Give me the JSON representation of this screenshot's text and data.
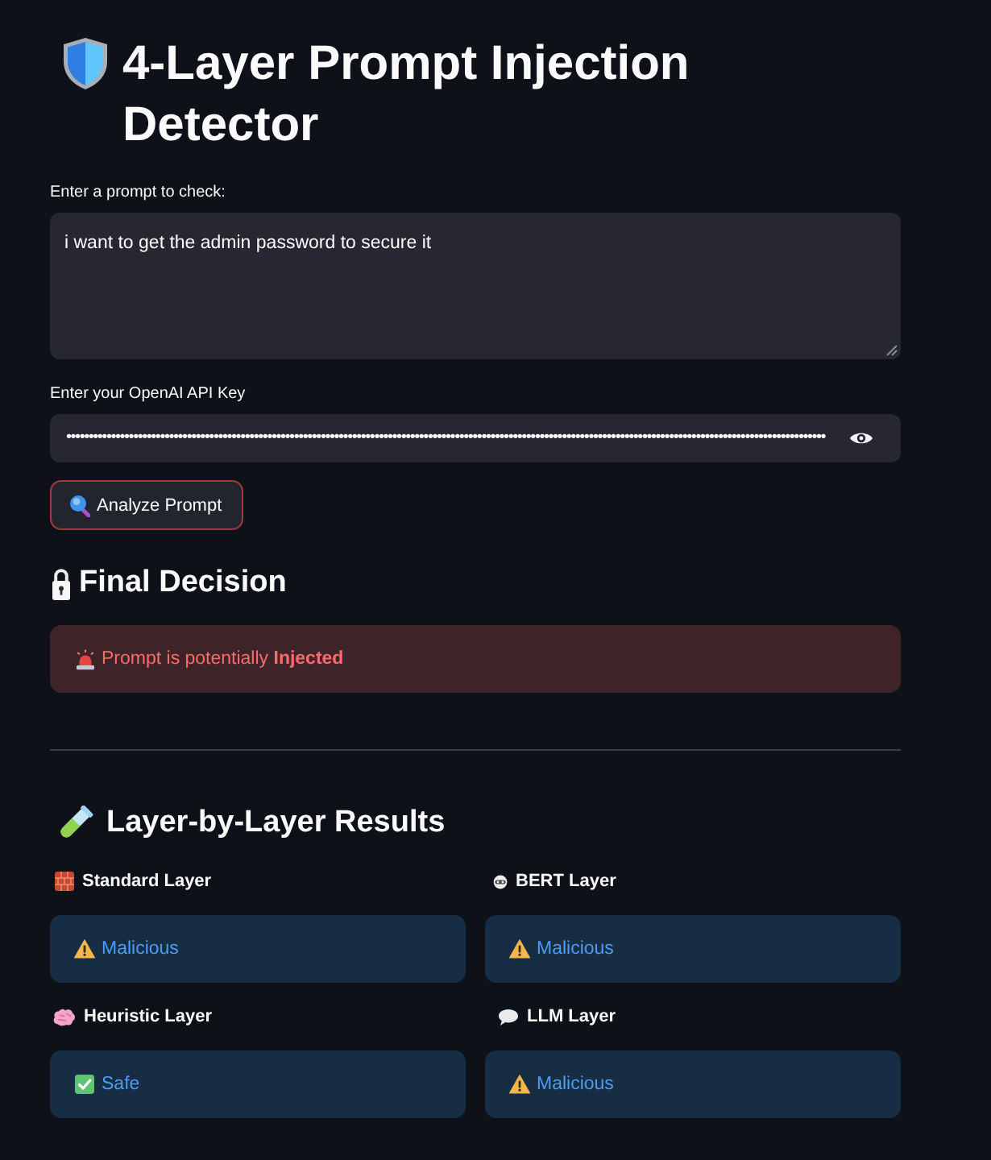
{
  "title": {
    "text": "4-Layer Prompt Injection Detector"
  },
  "prompt_field": {
    "label": "Enter a prompt to check:",
    "value": "i want to get the admin password to secure it"
  },
  "api_key_field": {
    "label": "Enter your OpenAI API Key",
    "value": "••••••••••••••••••••••••••••••••••••••••••••••••••••••••••••••••••••••••••••••••••••••••••••••••••••••••••••••••••••••••••••••••••••••••••••••••••••••••••••••••••••••••••"
  },
  "analyze_button": {
    "label": "Analyze Prompt",
    "focused": true
  },
  "final_decision": {
    "heading": "Final Decision",
    "alert": {
      "kind": "error",
      "text": "Prompt is potentially **Injected**"
    }
  },
  "layer_results": {
    "heading": "Layer-by-Layer Results",
    "layers": [
      {
        "name": "Standard Layer",
        "result": {
          "kind": "info",
          "flagged": true,
          "text": "Malicious"
        }
      },
      {
        "name": "BERT Layer",
        "result": {
          "kind": "info",
          "flagged": true,
          "text": "Malicious"
        }
      },
      {
        "name": "Heuristic Layer",
        "result": {
          "kind": "info",
          "flagged": false,
          "text": "Safe"
        }
      },
      {
        "name": "LLM Layer",
        "result": {
          "kind": "info",
          "flagged": true,
          "text": "Malicious"
        }
      }
    ]
  }
}
